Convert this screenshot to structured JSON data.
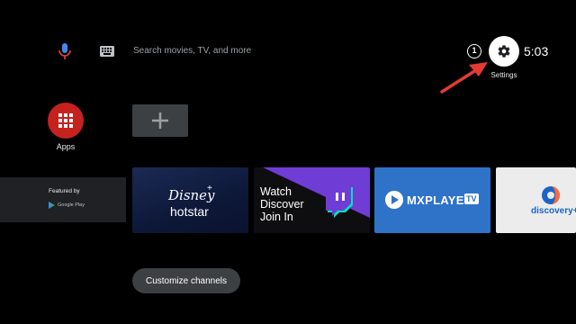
{
  "search": {
    "placeholder": "Search movies, TV, and more"
  },
  "status": {
    "notification_count": "1",
    "time": "5:03",
    "settings_label": "Settings"
  },
  "apps": {
    "label": "Apps"
  },
  "featured": {
    "label": "Featured by",
    "source": "Google Play"
  },
  "tiles": {
    "hotstar": {
      "disney": "Disney",
      "plus": "+",
      "name": "hotstar"
    },
    "twitch": {
      "line1": "Watch",
      "line2": "Discover",
      "line3": "Join In"
    },
    "mx": {
      "name": "MXPLAYER",
      "badge": "TV"
    },
    "discovery": {
      "name": "discovery+"
    }
  },
  "actions": {
    "customize": "Customize channels"
  },
  "colors": {
    "apps_red": "#c5221f",
    "mx_blue": "#2f73c9",
    "twitch_purple": "#6f3cd6",
    "arrow_red": "#e53935"
  }
}
